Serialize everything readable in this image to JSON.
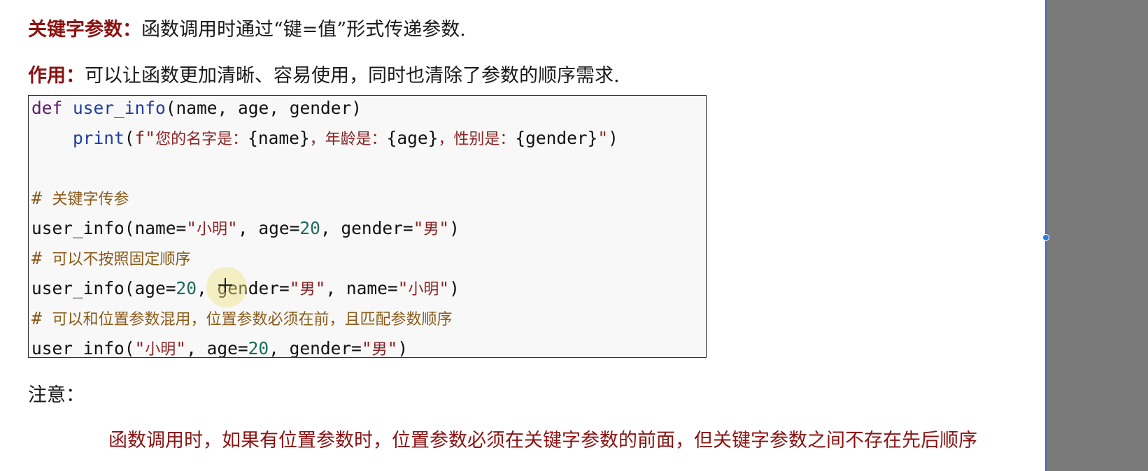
{
  "header": {
    "line1": {
      "term": "关键字参数：",
      "text": "函数调用时通过“键=值”形式传递参数."
    },
    "line2": {
      "term": "作用：",
      "text": "可以让函数更加清晰、容易使用，同时也清除了参数的顺序需求."
    }
  },
  "code": {
    "line1": {
      "kw": "def",
      "space": " ",
      "fn": "user_info",
      "rest": "(name, age, gender)"
    },
    "line2": {
      "indent": "    ",
      "fn": "print",
      "open": "(",
      "str_prefix": "f\"",
      "str_cn1": "您的名字是：",
      "str_var1": "{name}",
      "str_cn2": "，年龄是：",
      "str_var2": "{age}",
      "str_cn3": "，性别是：",
      "str_var3": "{gender}",
      "str_suffix": "\"",
      "close": ")"
    },
    "line3": "",
    "line4": {
      "hash": "# ",
      "text": "关键字传参"
    },
    "line5": {
      "prefix": "user_info(name=",
      "q1": "\"",
      "s1": "小明",
      "q2": "\"",
      "mid1": ", age=",
      "n1": "20",
      "mid2": ", gender=",
      "q3": "\"",
      "s2": "男",
      "q4": "\"",
      "end": ")"
    },
    "line6": {
      "hash": "# ",
      "text": "可以不按照固定顺序"
    },
    "line7": {
      "prefix": "user_info(age=",
      "n1": "20",
      "mid1": ", gender=",
      "q1": "\"",
      "s1": "男",
      "q2": "\"",
      "mid2": ", name=",
      "q3": "\"",
      "s2": "小明",
      "q4": "\"",
      "end": ")"
    },
    "line8": {
      "hash": "# ",
      "text": "可以和位置参数混用，位置参数必须在前，且匹配参数顺序"
    },
    "line9": {
      "prefix": "user_info(",
      "q1": "\"",
      "s1": "小明",
      "q2": "\"",
      "mid1": ", age=",
      "n1": "20",
      "mid2": ", gender=",
      "q3": "\"",
      "s2": "男",
      "q4": "\"",
      "end": ")"
    }
  },
  "note": {
    "label": "注意：",
    "text": "函数调用时，如果有位置参数时，位置参数必须在关键字参数的前面，但关键字参数之间不存在先后顺序"
  },
  "colors": {
    "term": "#8b1212",
    "keyword": "#5c1b6d",
    "function": "#1f3d9c",
    "string": "#8b2323",
    "number": "#1b6b5a",
    "comment": "#8a5a18",
    "sidebar": "#7a7a7a",
    "handle": "#2e7be0"
  },
  "icons": {
    "cursor": "crosshair-cursor-icon",
    "handle": "resize-handle-icon"
  }
}
